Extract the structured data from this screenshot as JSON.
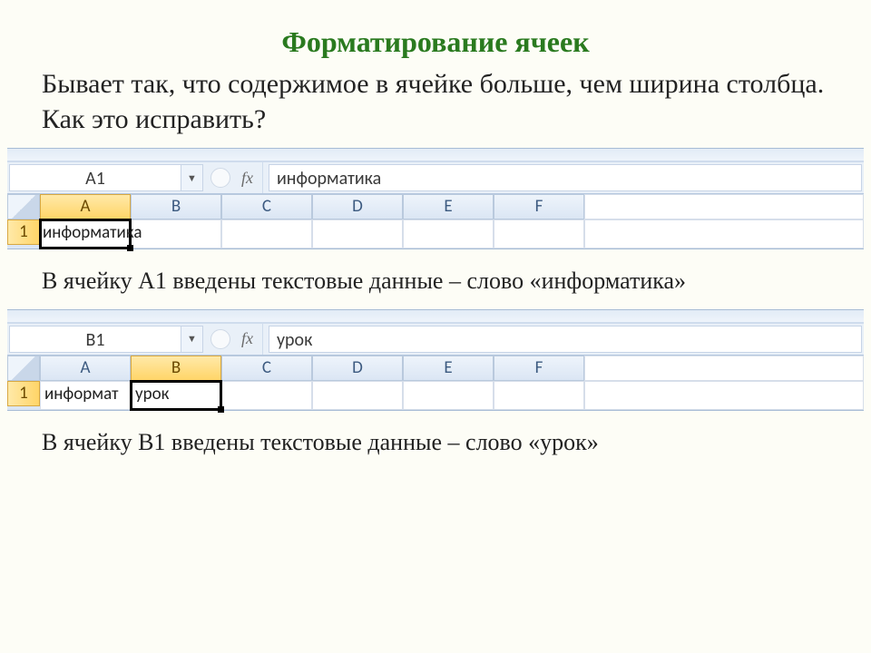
{
  "title": "Форматирование ячеек",
  "intro": "Бывает так, что содержимое в ячейке больше, чем ширина столбца. Как это исправить?",
  "excel1": {
    "name_box": "A1",
    "fx": "fx",
    "formula_value": "информатика",
    "columns": [
      "A",
      "B",
      "C",
      "D",
      "E",
      "F"
    ],
    "row_label": "1",
    "cell_a1": "информатика"
  },
  "caption1": "В ячейку А1 введены текстовые данные – слово «информатика»",
  "excel2": {
    "name_box": "B1",
    "fx": "fx",
    "formula_value": "урок",
    "columns": [
      "A",
      "B",
      "C",
      "D",
      "E",
      "F"
    ],
    "row_label": "1",
    "cell_a1": "информат",
    "cell_b1": "урок"
  },
  "caption2": "В ячейку В1 введены текстовые данные – слово «урок»"
}
